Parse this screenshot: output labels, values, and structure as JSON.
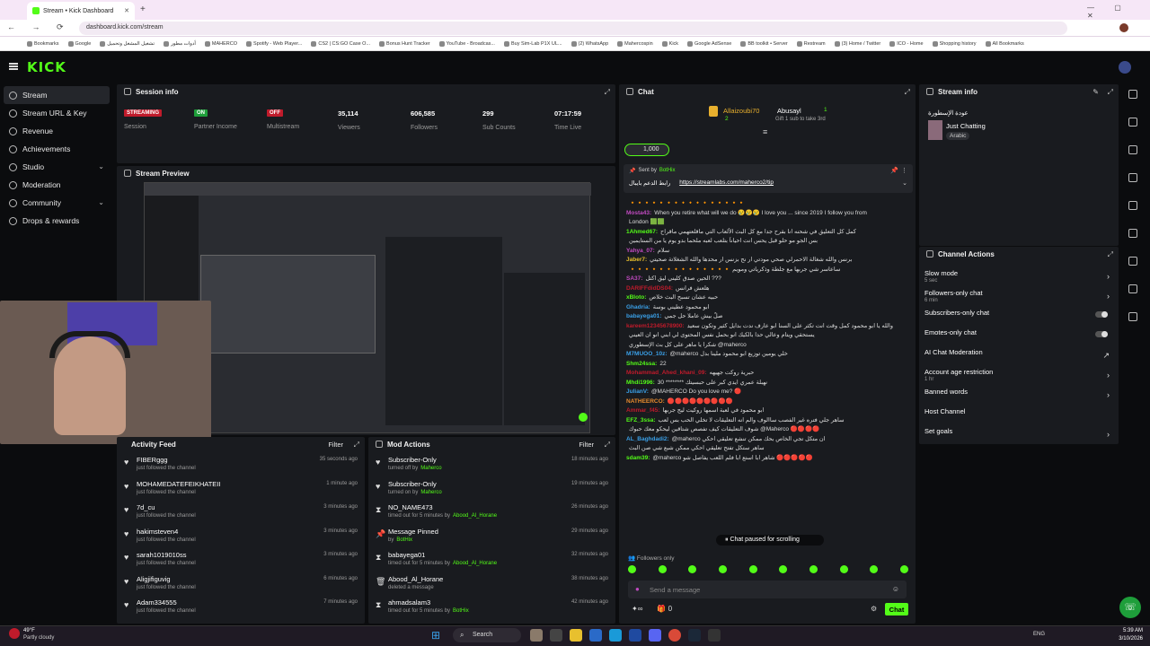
{
  "browser": {
    "tab_title": "Stream • Kick Dashboard",
    "url": "dashboard.kick.com/stream",
    "bookmarks": [
      "Bookmarks",
      "Google",
      "تشغيل المشغل وتحميل",
      "أدوات مطور",
      "MAHERCO",
      "Spotify - Web Player...",
      "CS2 | CS:GO Case O...",
      "Bonus Hunt Tracker",
      "YouTube - Broadcas...",
      "Buy Sim-Lab P1X UL...",
      "(2) WhatsApp",
      "Mahercospin",
      "Kick",
      "Google AdSense",
      "BB toolkit • Server",
      "Restream",
      "(3) Home / Twitter",
      "ICO - Home",
      "Shopping history",
      "All Bookmarks"
    ]
  },
  "kick": {
    "logo": "KICK"
  },
  "sidebar": [
    {
      "label": "Stream",
      "icon": "video-icon",
      "active": true
    },
    {
      "label": "Stream URL & Key",
      "icon": "key-icon"
    },
    {
      "label": "Revenue",
      "icon": "dollar-icon"
    },
    {
      "label": "Achievements",
      "icon": "trophy-icon"
    },
    {
      "label": "Studio",
      "icon": "studio-icon",
      "chevron": "⌄"
    },
    {
      "label": "Moderation",
      "icon": "shield-icon"
    },
    {
      "label": "Community",
      "icon": "community-icon",
      "chevron": "⌄"
    },
    {
      "label": "Drops & rewards",
      "icon": "gift-icon"
    }
  ],
  "session": {
    "title": "Session info",
    "stats": [
      {
        "value": "STREAMING",
        "label": "Session",
        "badge": "#c01b2b"
      },
      {
        "value": "ON",
        "label": "Partner Income",
        "badge": "#1e9e3a"
      },
      {
        "value": "OFF",
        "label": "Multistream",
        "badge": "#c01b2b"
      },
      {
        "value": "35,114",
        "label": "Viewers"
      },
      {
        "value": "606,585",
        "label": "Followers"
      },
      {
        "value": "299",
        "label": "Sub Counts"
      },
      {
        "value": "07:17:59",
        "label": "Time Live"
      }
    ]
  },
  "preview": {
    "title": "Stream Preview"
  },
  "activity": {
    "title": "Activity Feed",
    "filter": "Filter",
    "items": [
      {
        "name": "FIBERggg",
        "sub": "just followed the channel",
        "time": "35 seconds ago"
      },
      {
        "name": "MOHAMEDATEFEIKHATEII",
        "sub": "just followed the channel",
        "time": "1 minute ago"
      },
      {
        "name": "7d_cu",
        "sub": "just followed the channel",
        "time": "3 minutes ago"
      },
      {
        "name": "hakimsteven4",
        "sub": "just followed the channel",
        "time": "3 minutes ago"
      },
      {
        "name": "sarah1019010ss",
        "sub": "just followed the channel",
        "time": "3 minutes ago"
      },
      {
        "name": "Aligjifiguvig",
        "sub": "just followed the channel",
        "time": "6 minutes ago"
      },
      {
        "name": "Adam334555",
        "sub": "just followed the channel",
        "time": "7 minutes ago"
      }
    ]
  },
  "modactions": {
    "title": "Mod Actions",
    "filter": "Filter",
    "items": [
      {
        "name": "Subscriber-Only",
        "sub": "turned off by",
        "by": "Maherco",
        "time": "18 minutes ago",
        "icon": "heart"
      },
      {
        "name": "Subscriber-Only",
        "sub": "turned on by",
        "by": "Maherco",
        "time": "19 minutes ago",
        "icon": "heart"
      },
      {
        "name": "NO_NAME473",
        "sub": "timed out for 5 minutes by",
        "by": "Abood_Al_Horane",
        "time": "26 minutes ago",
        "icon": "hourglass"
      },
      {
        "name": "Message Pinned",
        "sub": "by",
        "by": "BotHix",
        "time": "29 minutes ago",
        "icon": "pin"
      },
      {
        "name": "babayega01",
        "sub": "timed out for 5 minutes by",
        "by": "Abood_Al_Horane",
        "time": "32 minutes ago",
        "icon": "hourglass"
      },
      {
        "name": "Abood_Al_Horane",
        "sub": "deleted a message",
        "by": "",
        "time": "38 minutes ago",
        "icon": "trash"
      },
      {
        "name": "ahmadsalam3",
        "sub": "timed out for 5 minutes by",
        "by": "BotHix",
        "time": "42 minutes ago",
        "icon": "hourglass"
      }
    ]
  },
  "chat": {
    "title": "Chat",
    "top_gifter_1": "Allaizoubi70",
    "top_gifter_1_count": "2",
    "top_gifter_2": "Abusayl",
    "top_gifter_2_count": "1",
    "gift_text": "Gift 1 sub to take 3rd",
    "goal": "1,000",
    "pinned_by": "Sent by",
    "pinned_user": "BotHix",
    "pinned_label": "رابط الدعم بايبال",
    "pinned_link": "https://streamlabs.com/maherco2/tip",
    "messages": [
      {
        "user": "",
        "text": "🔸🔸🔸🔸🔸🔸🔸🔸🔸🔸🔸🔸🔸🔸🔸🔸",
        "color": "#e88b2e"
      },
      {
        "user": "Mosta43:",
        "text": "When you retire what will we do 😢😢😢 I love you ... since 2019 I follow you from",
        "color": "#c04ac0"
      },
      {
        "user": "",
        "text": "London 🟩🟩",
        "color": "#fff"
      },
      {
        "user": "1Ahmed67:",
        "text": "كمل كل التعليق في شحنه انا بقرح جدا مع كل البث الألعاب التي ماقلعتهمي ماقراح",
        "color": "#53fc18"
      },
      {
        "user": "",
        "text": "بس الجو مو حلو قبل يحس انت احياناً بتلعب لعبه ملحما بدو يوم يا من الستايمين",
        "color": "#ddd"
      },
      {
        "user": "Yahya_07:",
        "text": "سلام",
        "color": "#c04ac0"
      },
      {
        "user": "Jaber7:",
        "text": "برنس والله شغالة الاحمرلي صحي مودتي ار نح بزنس ار محدها والله الشغلاتة صحيتي",
        "color": "#e8c02e"
      },
      {
        "user": "",
        "text": "🔸🔸🔸🔸🔸🔸🔸🔸🔸🔸🔸🔸🔸🔸 ساعاسر شي جربها مع جلطة وذكرياتي ومويم",
        "color": "#ddd"
      },
      {
        "user": "SA37:",
        "text": "الحين صدق كليني ليق اكتل ???",
        "color": "#c04ac0"
      },
      {
        "user": "DARIFFdidDS04:",
        "text": "هلعش فرانس",
        "color": "#c01b2b"
      },
      {
        "user": "xBloto:",
        "text": "حبيه عشان تسبح البث خلاص",
        "color": "#53fc18"
      },
      {
        "user": "Ghadria:",
        "text": "ابو محمود عطيني بوسة",
        "color": "#3aa0e8"
      },
      {
        "user": "babayega01:",
        "text": "صلّ بيش عاملا حل جمي",
        "color": "#3aa0e8"
      },
      {
        "user": "kareem12345678900:",
        "text": "والله يا ابو محمود كمل وقت انت تكثر على السنا ابو عارف ندت بدايل كثير وتكون سعيد",
        "color": "#c01b2b"
      },
      {
        "user": "",
        "text": "يستحقي ويتام وعالي حدا بالكيك انو بحمل نفس المحتوى لي ابني انو ان العيني",
        "color": "#ddd"
      },
      {
        "user": "",
        "text": "شكرا يا ماهر على كل بث الإسطوري @maherco",
        "color": "#ddd"
      },
      {
        "user": "M7MUOO_10z:",
        "text": "@maherco خلي يومين توزيع ابو محمود ملينا بدل",
        "color": "#3aa0e8"
      },
      {
        "user": "Shm24ssa:",
        "text": "22",
        "color": "#53fc18"
      },
      {
        "user": "Mohammad_Ahed_khani_09:",
        "text": "حبرية روكت جهيهه",
        "color": "#c01b2b"
      },
      {
        "user": "Mhdi1996:",
        "text": "30 ******** نهبلة عمري ايدي كبر على حبسيتك",
        "color": "#53fc18"
      },
      {
        "user": "JulianV:",
        "text": "@MAHERCO Do you love me? 🔴",
        "color": "#3aa0e8"
      },
      {
        "user": "NATHEERCO:",
        "text": "🔴🔴🔴🔴🔴🔴🔴🔴🔴",
        "color": "#e88b2e"
      },
      {
        "user": "Ammar_f45:",
        "text": "ابو محمود في لعبة اسمها روكيت ليج جربها",
        "color": "#c01b2b"
      },
      {
        "user": "EFZ_3ssa:",
        "text": "ساهر جلي فتره غير الفصب ساالوف والم انه التعليقات لا تخلي الحب بس لعب",
        "color": "#53fc18"
      },
      {
        "user": "",
        "text": "شوف التعليقات كيف تفصص شتاقين ليحكو معك حبوك @Maherco 🔴🔴🔴🔴",
        "color": "#ddd"
      },
      {
        "user": "AL_Baghdadi2:",
        "text": "@maherco ان متكل تجي الخاص بحك ممكن تنشع تعليقي احكي",
        "color": "#3aa0e8"
      },
      {
        "user": "",
        "text": "ساهر ستكل تفتح تعليقي احكي ممكن شبع شي صن البث",
        "color": "#ddd"
      },
      {
        "user": "sdam39:",
        "text": "@maherco شاهر ابا استع ابا فلم اللعب يفاصل شو 🔴🔴🔴🔴🔴",
        "color": "#53fc18"
      }
    ],
    "paused": "Chat paused for scrolling",
    "followers_only": "Followers only",
    "placeholder": "Send a message",
    "send": "Chat",
    "infinite": "∞",
    "count": "0"
  },
  "streaminfo": {
    "title": "Stream info",
    "stream_title": "عودة الإسطورة",
    "category": "Just Chatting",
    "language": "Arabic"
  },
  "channelactions": {
    "title": "Channel Actions",
    "items": [
      {
        "label": "Slow mode",
        "sub": "5 sec",
        "right": "›"
      },
      {
        "label": "Followers-only chat",
        "sub": "6 min",
        "right": "›"
      },
      {
        "label": "Subscribers-only chat",
        "sub": "",
        "right": "toggle"
      },
      {
        "label": "Emotes-only chat",
        "sub": "",
        "right": "toggle"
      },
      {
        "label": "AI Chat Moderation",
        "sub": "",
        "right": "↗"
      },
      {
        "label": "Account age restriction",
        "sub": "1 hr",
        "right": "›"
      },
      {
        "label": "Banned words",
        "sub": "",
        "right": "›"
      },
      {
        "label": "Host Channel",
        "sub": "",
        "right": ""
      },
      {
        "label": "Set goals",
        "sub": "",
        "right": "›"
      }
    ]
  },
  "taskbar": {
    "weather_temp": "49°F",
    "weather_desc": "Partly cloudy",
    "search": "Search",
    "lang": "ENG",
    "time": "5:39 AM",
    "date": "3/10/2026"
  },
  "colors": {
    "accent": "#53fc18",
    "panel": "#191b1f",
    "bg": "#0b0c0e"
  }
}
